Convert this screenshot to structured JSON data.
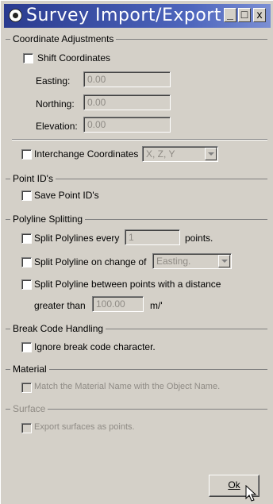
{
  "window": {
    "title": "Survey Import/Export",
    "minimize_label": "_",
    "maximize_label": "□",
    "close_label": "x"
  },
  "coordinate_adjustments": {
    "group_label": "Coordinate Adjustments",
    "shift_label": "Shift Coordinates",
    "easting_label": "Easting:",
    "easting_value": "0.00",
    "northing_label": "Northing:",
    "northing_value": "0.00",
    "elevation_label": "Elevation:",
    "elevation_value": "0.00",
    "interchange_label": "Interchange Coordinates",
    "interchange_value": "X, Z, Y"
  },
  "point_ids": {
    "group_label": "Point ID's",
    "save_label": "Save Point ID's"
  },
  "polyline_splitting": {
    "group_label": "Polyline Splitting",
    "split_every_label": "Split Polylines every",
    "split_every_value": "1",
    "points_label": "points.",
    "split_change_label": "Split Polyline on change of",
    "split_change_value": "Easting.",
    "split_distance_label": "Split Polyline between points with a distance",
    "greater_than_label": "greater than",
    "greater_than_value": "100.00",
    "unit_label": "m/'"
  },
  "break_code": {
    "group_label": "Break Code Handling",
    "ignore_label": "Ignore break code character."
  },
  "material": {
    "group_label": "Material",
    "match_label": "Match the Material Name with the Object Name."
  },
  "surface": {
    "group_label": "Surface",
    "export_label": "Export surfaces as points."
  },
  "ok_label": "Ok"
}
